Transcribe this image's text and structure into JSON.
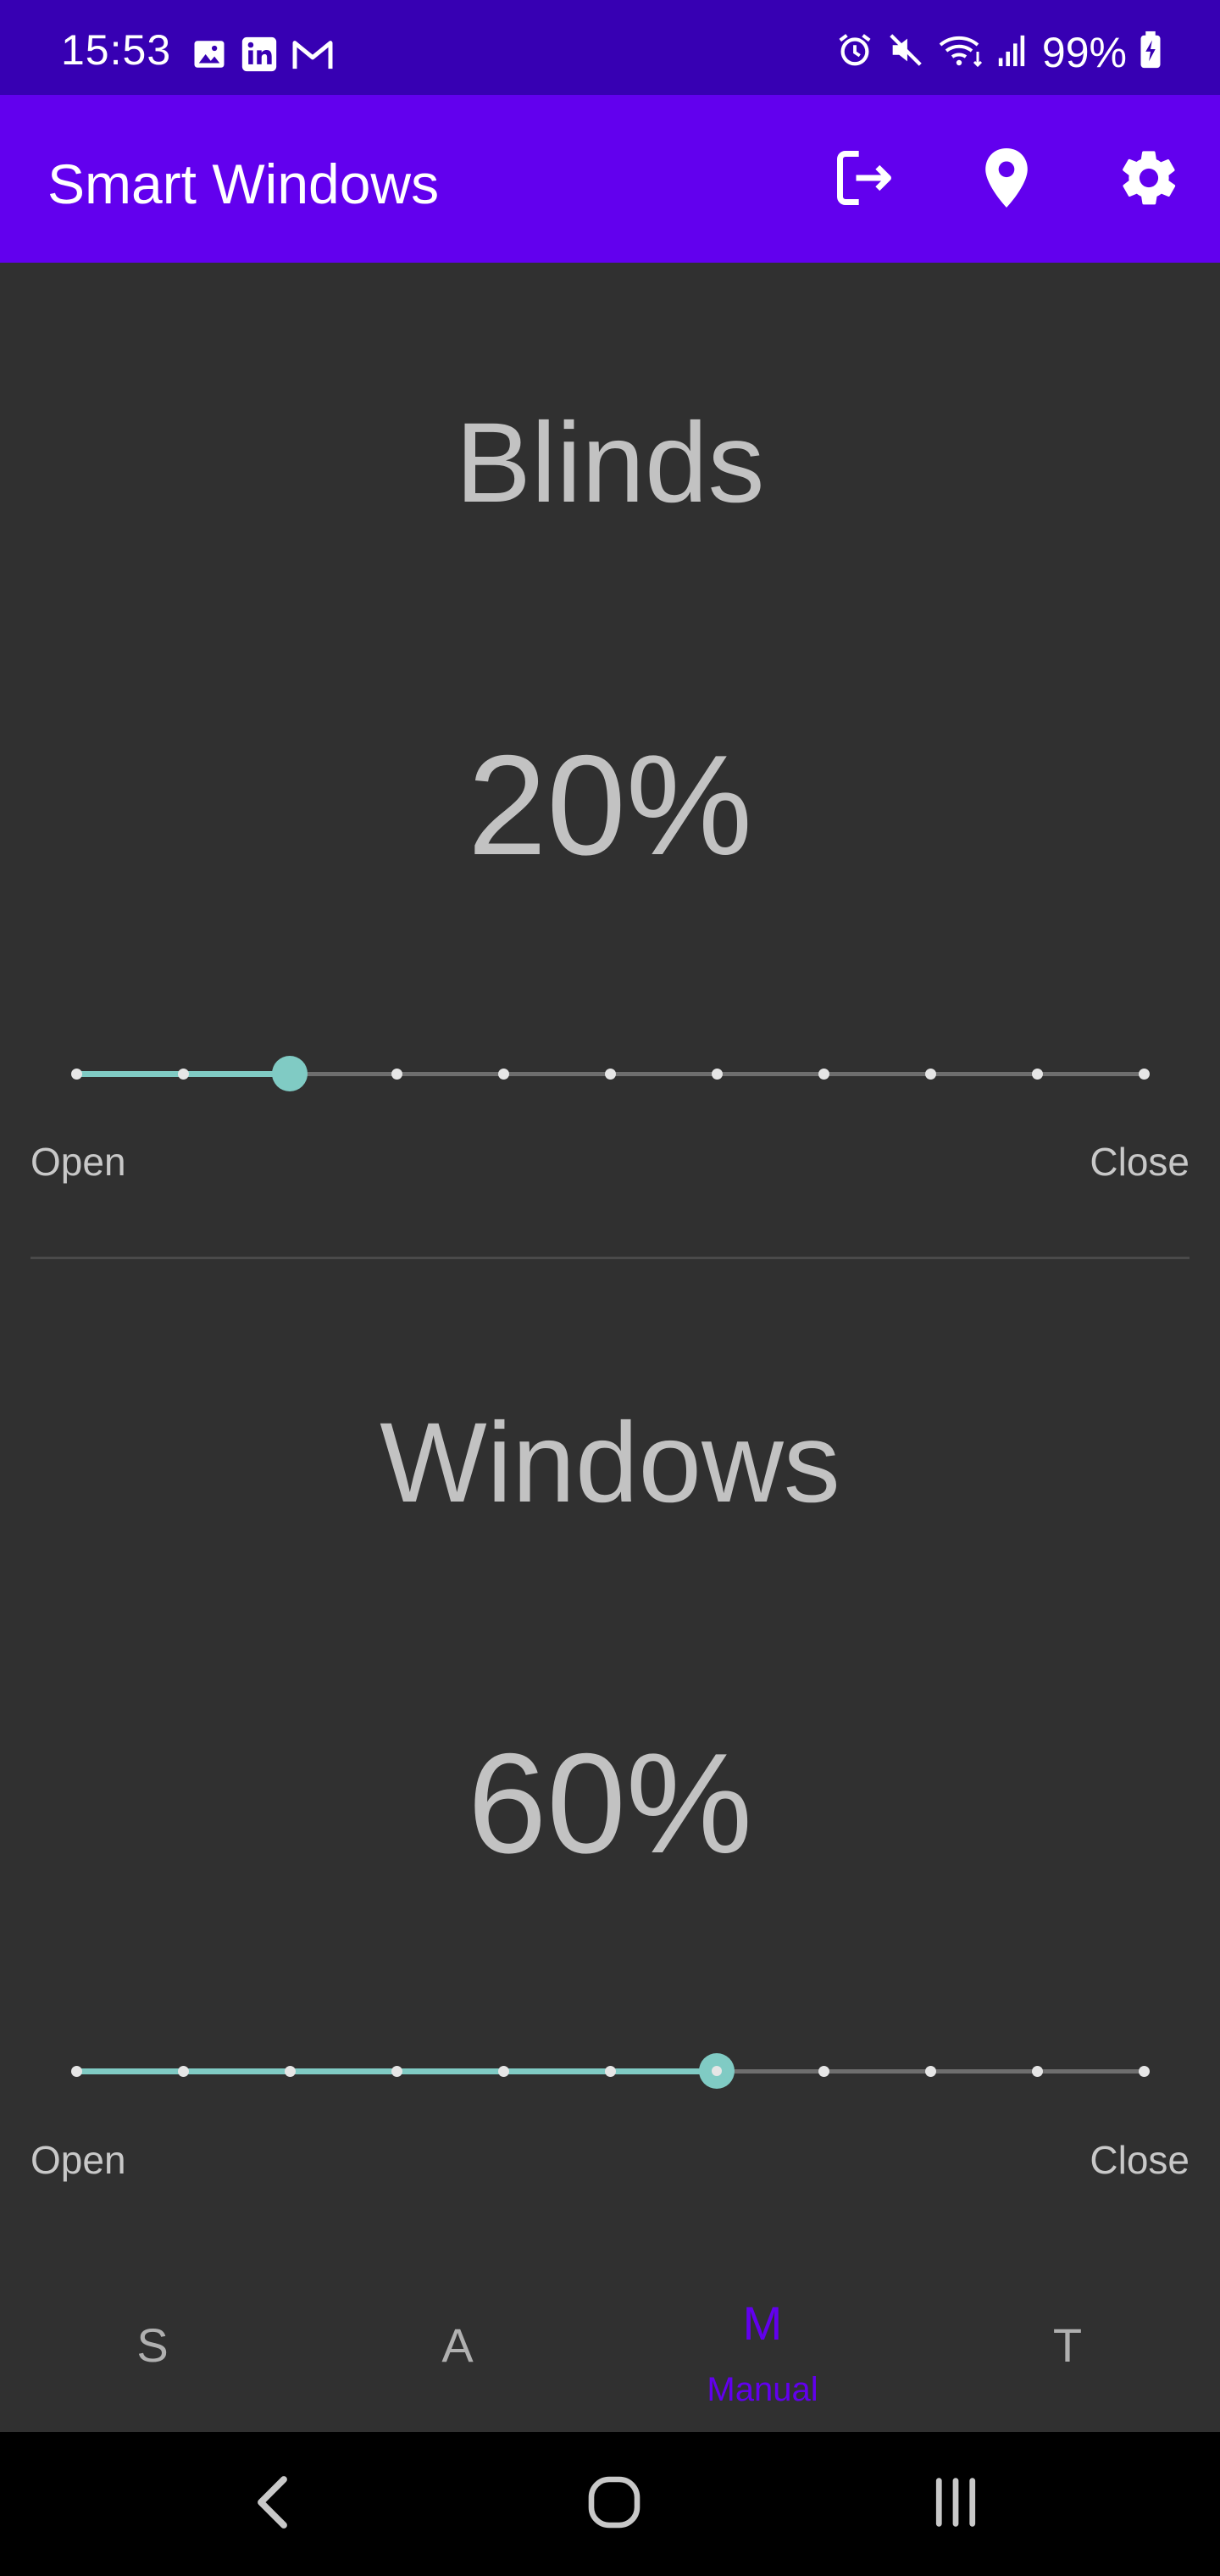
{
  "status_bar": {
    "time": "15:53",
    "battery": "99%",
    "left_icons": [
      "gallery-icon",
      "linkedin-icon",
      "gmail-icon"
    ],
    "right_icons": [
      "alarm-icon",
      "mute-icon",
      "wifi-icon",
      "signal-icon",
      "battery-charging-icon"
    ]
  },
  "app_bar": {
    "title": "Smart Windows",
    "actions": [
      "logout-icon",
      "location-icon",
      "settings-icon"
    ],
    "color": "#6200ee"
  },
  "controls": [
    {
      "title": "Blinds",
      "value_text": "20%",
      "value": 20,
      "steps": 10,
      "open_label": "Open",
      "close_label": "Close"
    },
    {
      "title": "Windows",
      "value_text": "60%",
      "value": 60,
      "steps": 10,
      "open_label": "Open",
      "close_label": "Close"
    }
  ],
  "bottom_nav": {
    "items": [
      {
        "letter": "S",
        "caption": "",
        "active": false
      },
      {
        "letter": "A",
        "caption": "",
        "active": false
      },
      {
        "letter": "M",
        "caption": "Manual",
        "active": true
      },
      {
        "letter": "T",
        "caption": "",
        "active": false
      }
    ]
  },
  "colors": {
    "accent": "#80cbc4",
    "primary": "#6200ee",
    "primary_dark": "#3700b3",
    "background": "#303030"
  }
}
